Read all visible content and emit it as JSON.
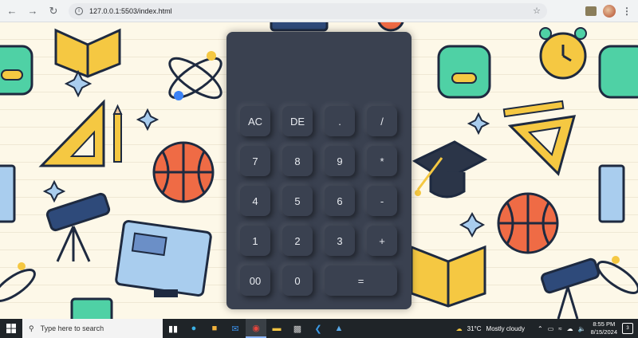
{
  "browser": {
    "url": "127.0.0.1:5503/index.html",
    "back_icon": "arrow-left-icon",
    "forward_icon": "arrow-right-icon",
    "reload_icon": "reload-icon",
    "star_icon": "star-icon"
  },
  "calculator": {
    "display": "",
    "keys": [
      "AC",
      "DE",
      ".",
      "/",
      "7",
      "8",
      "9",
      "*",
      "4",
      "5",
      "6",
      "-",
      "1",
      "2",
      "3",
      "+",
      "00",
      "0",
      "="
    ]
  },
  "taskbar": {
    "search_placeholder": "Type here to search",
    "weather_temp": "31°C",
    "weather_text": "Mostly cloudy",
    "time": "8:55 PM",
    "date": "8/15/2024",
    "notification_count": "3"
  },
  "colors": {
    "calc_bg": "#3a4150",
    "wallpaper": "#fdf8e8",
    "taskbar": "#1f2428"
  }
}
